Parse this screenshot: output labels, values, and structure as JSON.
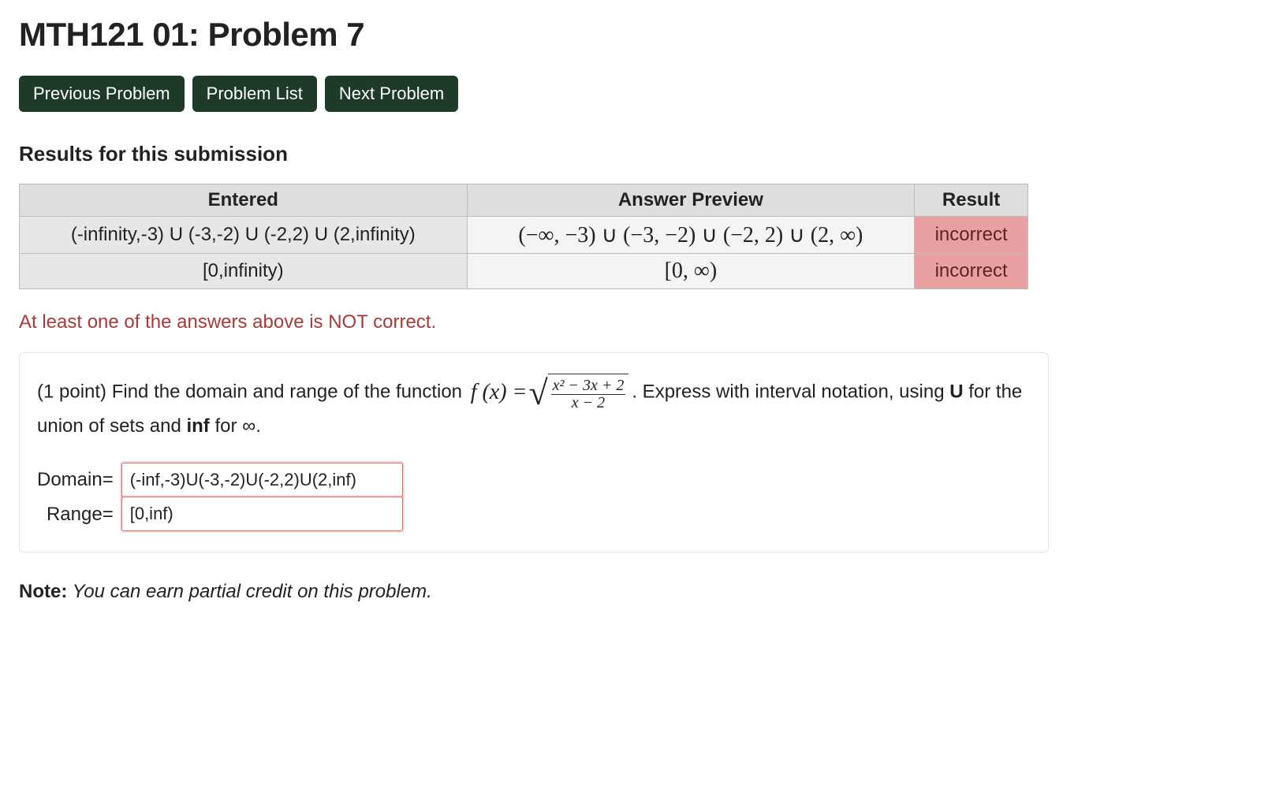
{
  "title": "MTH121 01: Problem 7",
  "nav": {
    "prev": "Previous Problem",
    "list": "Problem List",
    "next": "Next Problem"
  },
  "results_heading": "Results for this submission",
  "table": {
    "headers": {
      "entered": "Entered",
      "preview": "Answer Preview",
      "result": "Result"
    },
    "rows": [
      {
        "entered": "(-infinity,-3) U (-3,-2) U (-2,2) U (2,infinity)",
        "preview": "(−∞, −3) ∪ (−3, −2) ∪ (−2, 2) ∪ (2, ∞)",
        "result": "incorrect"
      },
      {
        "entered": "[0,infinity)",
        "preview": "[0, ∞)",
        "result": "incorrect"
      }
    ]
  },
  "feedback": "At least one of the answers above is NOT correct.",
  "problem": {
    "points": "(1 point)",
    "lead": " Find the domain and range of the function ",
    "fn_lhs": "f (x) =",
    "frac_num": "x² − 3x + 2",
    "frac_den": "x − 2",
    "tail1": ". Express with interval notation, using ",
    "u_bold": "U",
    "tail2": " for the union of sets and ",
    "inf_bold": "inf",
    "tail3": " for ",
    "inf_sym": "∞",
    "tail4": "."
  },
  "answers": {
    "domain_label": "Domain=",
    "domain_value": "(-inf,-3)U(-3,-2)U(-2,2)U(2,inf)",
    "range_label": "Range=",
    "range_value": "[0,inf)"
  },
  "note": {
    "label": "Note:",
    "text": " You can earn partial credit on this problem."
  }
}
